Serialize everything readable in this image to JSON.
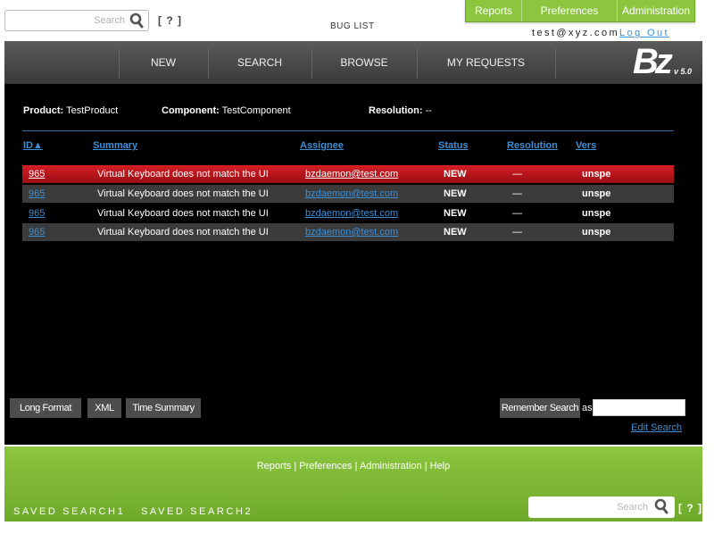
{
  "header": {
    "search_placeholder": "Search",
    "help": "[ ? ]",
    "page_title": "BUG LIST",
    "top_nav": [
      "Reports",
      "Preferences",
      "Administration"
    ],
    "user_email": "test@xyz.com",
    "logout": "Log Out"
  },
  "main_nav": {
    "items": [
      "NEW",
      "SEARCH",
      "BROWSE",
      "MY REQUESTS"
    ],
    "logo": "Bz",
    "version": "v 5.0"
  },
  "meta": {
    "product_label": "Product:",
    "product_value": "TestProduct",
    "component_label": "Component:",
    "component_value": "TestComponent",
    "resolution_label": "Resolution:",
    "resolution_value": "--"
  },
  "table": {
    "columns": [
      "ID▲",
      "Summary",
      "Assignee",
      "Status",
      "Resolution",
      "Vers"
    ],
    "rows": [
      {
        "id": "965",
        "summary": "Virtual Keyboard does not match the UI",
        "assignee": "bzdaemon@test.com",
        "status": "NEW",
        "resolution": "—",
        "version": "unspe"
      },
      {
        "id": "965",
        "summary": "Virtual Keyboard does not match the UI",
        "assignee": "bzdaemon@test.com",
        "status": "NEW",
        "resolution": "—",
        "version": "unspe"
      },
      {
        "id": "965",
        "summary": "Virtual Keyboard does not match the UI",
        "assignee": "bzdaemon@test.com",
        "status": "NEW",
        "resolution": "—",
        "version": "unspe"
      },
      {
        "id": "965",
        "summary": "Virtual Keyboard does not match the UI",
        "assignee": "bzdaemon@test.com",
        "status": "NEW",
        "resolution": "—",
        "version": "unspe"
      }
    ]
  },
  "actions": {
    "long_format": "Long Format",
    "xml": "XML",
    "time_summary": "Time Summary",
    "remember_search": "Remember Search",
    "as_label": "as",
    "edit_search": "Edit Search"
  },
  "footer": {
    "links": [
      "Reports",
      "Preferences",
      "Administration",
      "Help"
    ],
    "saved_searches": [
      "SAVED SEARCH1",
      "SAVED SEARCH2"
    ],
    "search_placeholder": "Search",
    "help": "[ ? ]"
  },
  "colors": {
    "accent_green": "#8cc63f",
    "highlight_red": "#d41e24",
    "link_blue": "#3d8fd6",
    "nav_dark": "#4a4a4a"
  }
}
